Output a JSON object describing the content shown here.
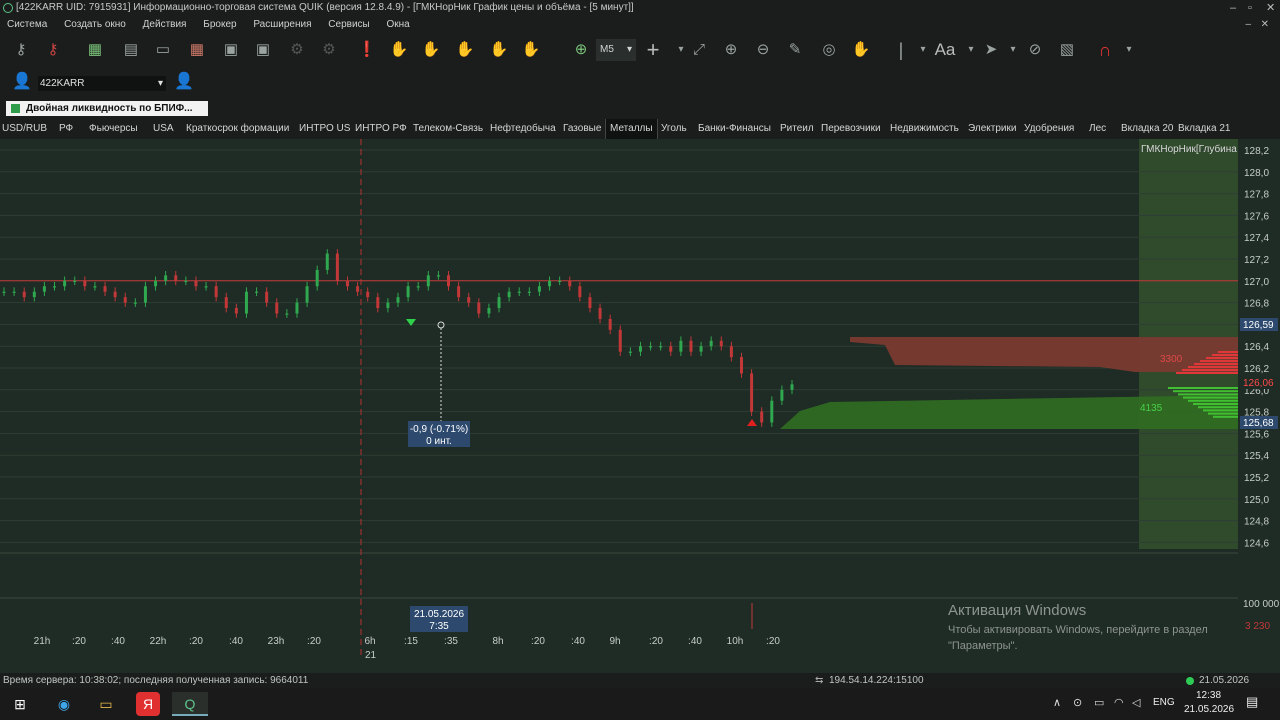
{
  "window": {
    "title": "[422KARR UID: 7915931] Информационно-торговая система QUIK (версия 12.8.4.9) - [ГМКНорНик График цены и объёма - [5 минут]]"
  },
  "menu": [
    "Система",
    "Создать окно",
    "Действия",
    "Брокер",
    "Расширения",
    "Сервисы",
    "Окна"
  ],
  "toolbar": {
    "interval": "M5",
    "font_label": "Aa"
  },
  "account": {
    "selected": "422KARR"
  },
  "notice": "Двойная ликвидность по  БПИФ...",
  "tabs": [
    "USD/RUB",
    "РФ",
    "Фьючерсы",
    "USA",
    "Краткосрок формации",
    "ИНТРО US",
    "ИНТРО РФ",
    "Телеком-Связь",
    "Нефтедобыча",
    "Газовые",
    "Металлы",
    "Уголь",
    "Банки-Финансы",
    "Ритеил",
    "Перевозчики",
    "Недвижимость",
    "Электрики",
    "Удобрения",
    "Лес",
    "Вкладка 20",
    "Вкладка 21"
  ],
  "chart": {
    "depth_title": "ГМКНорНик[Глубина",
    "y_ticks": [
      "128,2",
      "128,0",
      "127,8",
      "127,6",
      "127,4",
      "127,2",
      "127,0",
      "126,8",
      "126,6",
      "126,4",
      "126,2",
      "126,0",
      "125,8",
      "125,6",
      "125,4",
      "125,2",
      "125,0",
      "124,8",
      "124,6"
    ],
    "last_price": "126,59",
    "ask_label": "126,06",
    "bid_label": "125,68",
    "ask_volume": "3300",
    "bid_volume": "4135",
    "measure_line1": "-0,9 (-0.71%)",
    "measure_line2": "0 инт.",
    "volume_max": "100 000",
    "volume_last": "3 230",
    "cursor_date": "21.05.2026",
    "cursor_time": "7:35",
    "x_ticks": [
      "21h",
      ":20",
      ":40",
      "22h",
      ":20",
      ":40",
      "23h",
      ":20",
      "6h",
      ":15",
      ":35",
      "8h",
      ":20",
      ":40",
      "9h",
      ":20",
      ":40",
      "10h",
      ":20"
    ],
    "day_label": "21"
  },
  "chart_data": {
    "type": "line",
    "ylim": [
      124.5,
      128.3
    ],
    "reference_level": 127.0,
    "closes": [
      126.9,
      126.9,
      126.85,
      126.9,
      126.95,
      126.95,
      127.0,
      127.0,
      126.95,
      126.95,
      126.9,
      126.85,
      126.8,
      126.8,
      126.95,
      127.0,
      127.05,
      127.0,
      127.0,
      126.95,
      126.95,
      126.85,
      126.75,
      126.7,
      126.9,
      126.9,
      126.8,
      126.7,
      126.7,
      126.8,
      126.95,
      127.1,
      127.25,
      127.0,
      126.95,
      126.9,
      126.85,
      126.75,
      126.8,
      126.85,
      126.95,
      126.95,
      127.05,
      127.05,
      126.95,
      126.85,
      126.8,
      126.7,
      126.75,
      126.85,
      126.9,
      126.9,
      126.9,
      126.95,
      127.0,
      127.0,
      126.95,
      126.85,
      126.75,
      126.65,
      126.55,
      126.35,
      126.35,
      126.4,
      126.4,
      126.4,
      126.35,
      126.45,
      126.35,
      126.4,
      126.45,
      126.4,
      126.3,
      126.15,
      125.8,
      125.7,
      125.9,
      126.0,
      126.05
    ],
    "depth": {
      "ask_volume": 3300,
      "bid_volume": 4135
    }
  },
  "activation": {
    "title": "Активация Windows",
    "line1": "Чтобы активировать Windows, перейдите в раздел",
    "line2": "\"Параметры\"."
  },
  "status": {
    "server": "Время сервера: 10:38:02; последняя полученная запись: 9664011",
    "connection": "194.54.14.224:15100",
    "date": "21.05.2026"
  },
  "taskbar": {
    "lang": "ENG",
    "time": "12:38",
    "date": "21.05.2026"
  }
}
